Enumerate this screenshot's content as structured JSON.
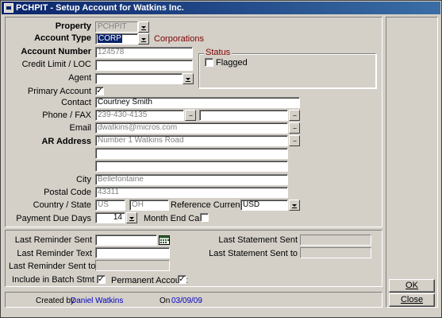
{
  "window": {
    "title": "PCHPIT - Setup Account for Watkins Inc."
  },
  "form": {
    "property": {
      "label": "Property",
      "value": "PCHPIT"
    },
    "account_type": {
      "label": "Account Type",
      "value": "CORP",
      "description": "Corporations"
    },
    "account_number": {
      "label": "Account Number",
      "value": "124578"
    },
    "credit_limit": {
      "label": "Credit Limit / LOC",
      "value": ""
    },
    "agent": {
      "label": "Agent",
      "value": ""
    },
    "primary_account": {
      "label": "Primary Account",
      "checked": true
    },
    "status": {
      "group_label": "Status",
      "flagged_label": "Flagged",
      "flagged_checked": false
    },
    "contact": {
      "label": "Contact",
      "value": "Courtney Smith"
    },
    "phone_fax": {
      "label": "Phone / FAX",
      "phone": "239-430-4135",
      "fax": ""
    },
    "email": {
      "label": "Email",
      "value": "dwatkins@micros.com"
    },
    "ar_address": {
      "label": "AR Address",
      "line1": "Number 1 Watkins Road",
      "line2": "",
      "line3": "",
      "line4": ""
    },
    "city": {
      "label": "City",
      "value": "Bellefontaine"
    },
    "postal_code": {
      "label": "Postal Code",
      "value": "43311"
    },
    "country_state": {
      "label": "Country / State",
      "country": "US",
      "state": "OH"
    },
    "reference_currency": {
      "label": "Reference Currency",
      "value": "USD"
    },
    "payment_due_days": {
      "label": "Payment Due Days",
      "value": "14"
    },
    "month_end_calc": {
      "label": "Month End Calc.",
      "checked": false
    }
  },
  "reminders": {
    "last_reminder_sent": {
      "label": "Last Reminder Sent",
      "value": ""
    },
    "last_reminder_text": {
      "label": "Last Reminder Text",
      "value": ""
    },
    "last_reminder_sent_to": {
      "label": "Last Reminder Sent to",
      "value": ""
    },
    "include_in_batch": {
      "label": "Include in Batch Stmt",
      "checked": true
    },
    "permanent_account": {
      "label": "Permanent Account",
      "checked": true
    },
    "last_statement_sent": {
      "label": "Last Statement Sent",
      "value": ""
    },
    "last_statement_sent_to": {
      "label": "Last Statement Sent to",
      "value": ""
    }
  },
  "footer": {
    "created_by_label": "Created by",
    "created_by": "Daniel Watkins",
    "on_label": "On",
    "created_on": "03/09/09"
  },
  "buttons": {
    "ok": "OK",
    "close": "Close"
  },
  "check_glyph": "✓"
}
